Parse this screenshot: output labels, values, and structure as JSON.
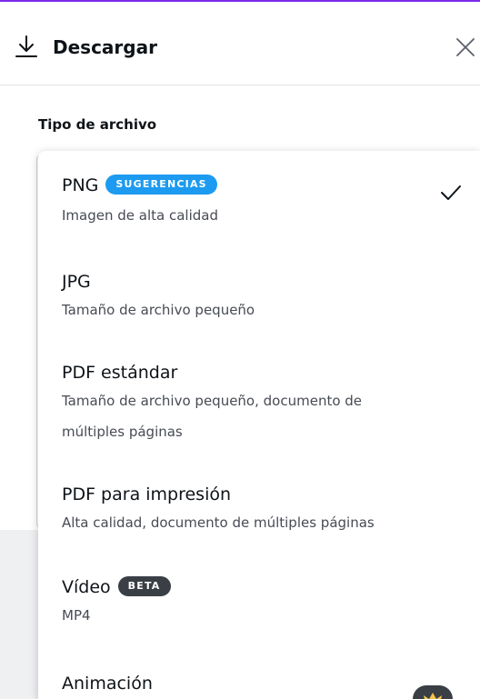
{
  "header": {
    "title": "Descargar",
    "download_icon": "download-icon",
    "close_icon": "close-icon"
  },
  "file_type": {
    "label": "Tipo de archivo"
  },
  "options": [
    {
      "title": "PNG",
      "badge": "SUGERENCIAS",
      "description": "Imagen de alta calidad",
      "selected": true
    },
    {
      "title": "JPG",
      "description": "Tamaño de archivo pequeño"
    },
    {
      "title": "PDF estándar",
      "description_lines": [
        "Tamaño de archivo pequeño, documento de",
        "múltiples páginas"
      ]
    },
    {
      "title": "PDF para impresión",
      "description": "Alta calidad, documento de múltiples páginas"
    },
    {
      "title": "Vídeo",
      "badge": "BETA",
      "description": "MP4"
    },
    {
      "title": "Animación",
      "premium_icon": "crown-icon"
    }
  ],
  "colors": {
    "accent": "#7d2ae8",
    "badge_blue": "#1d9bf0",
    "badge_dark": "#3a3f45",
    "crown": "#f5c24a"
  }
}
